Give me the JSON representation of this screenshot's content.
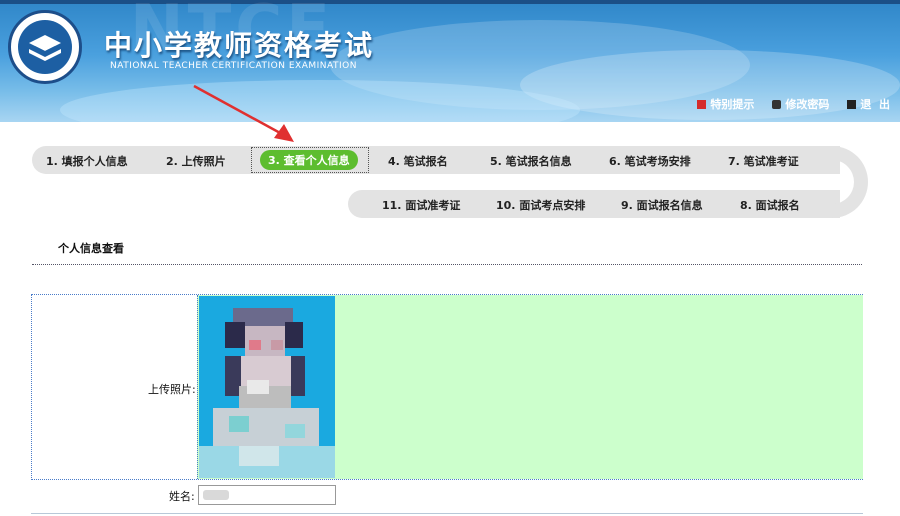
{
  "header": {
    "watermark": "NTCE",
    "title_cn": "中小学教师资格考试",
    "title_en": "NATIONAL TEACHER CERTIFICATION EXAMINATION",
    "links": [
      {
        "label": "特别提示",
        "icon": "alert-icon"
      },
      {
        "label": "修改密码",
        "icon": "key-icon"
      },
      {
        "label": "退  出",
        "icon": "logout-icon"
      }
    ]
  },
  "steps": {
    "row1": [
      "1. 填报个人信息",
      "2. 上传照片",
      "3. 查看个人信息",
      "4. 笔试报名",
      "5. 笔试报名信息",
      "6. 笔试考场安排",
      "7. 笔试准考证"
    ],
    "row2": [
      "11. 面试准考证",
      "10. 面试考点安排",
      "9. 面试报名信息",
      "8. 面试报名"
    ],
    "active_index": 2
  },
  "section": {
    "title": "个人信息查看",
    "photo_label": "上传照片:",
    "name_label": "姓名:"
  },
  "colors": {
    "active_step": "#5dbd2f",
    "info_bg": "#ccffcc",
    "arrow": "#e03030"
  }
}
